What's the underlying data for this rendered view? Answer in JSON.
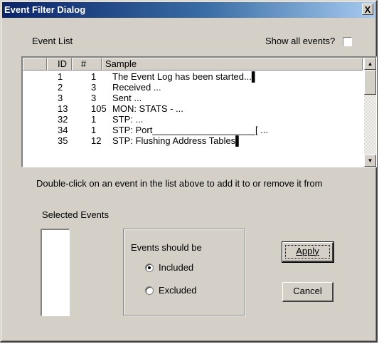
{
  "window": {
    "title": "Event Filter Dialog",
    "close_glyph": "X"
  },
  "event_list": {
    "label": "Event List",
    "show_all_label": "Show all events?",
    "show_all_checked": false,
    "columns": [
      "ID",
      "#",
      "Sample"
    ],
    "rows": [
      {
        "id": "1",
        "count": "1",
        "sample": "The Event Log has been started...▌"
      },
      {
        "id": "2",
        "count": "3",
        "sample": "Received  ..."
      },
      {
        "id": "3",
        "count": "3",
        "sample": "Sent  ..."
      },
      {
        "id": "13",
        "count": "105",
        "sample": "MON: STATS - ..."
      },
      {
        "id": "32",
        "count": "1",
        "sample": "STP:  ..."
      },
      {
        "id": "34",
        "count": "1",
        "sample": "STP: Port____________________[ ..."
      },
      {
        "id": "35",
        "count": "12",
        "sample": "STP: Flushing Address Tables▌"
      }
    ],
    "scroll_up_icon": "triangle-up",
    "scroll_down_icon": "triangle-down"
  },
  "instruction": "Double-click on an event in the list above to add it to or remove it from",
  "selected_events": {
    "label": "Selected Events"
  },
  "events_group": {
    "label": "Events should be",
    "options": [
      {
        "label": "Included",
        "selected": true
      },
      {
        "label": "Excluded",
        "selected": false
      }
    ]
  },
  "buttons": {
    "apply": "Apply",
    "cancel": "Cancel"
  }
}
